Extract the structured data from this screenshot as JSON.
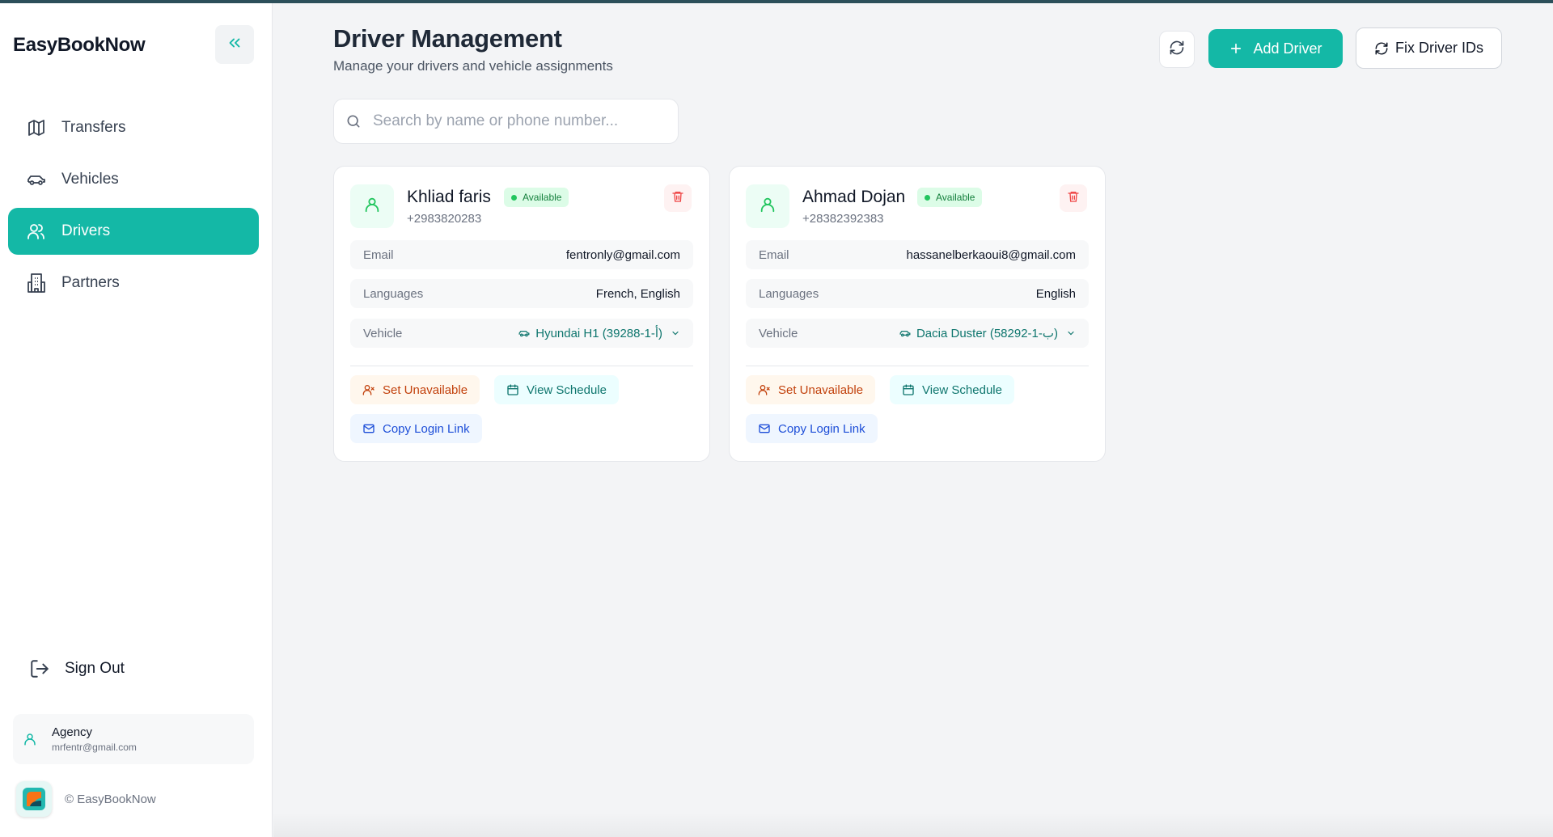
{
  "app": {
    "brand": "EasyBookNow",
    "copyright": "© EasyBookNow"
  },
  "sidebar": {
    "items": [
      {
        "label": "Transfers",
        "icon": "map-icon"
      },
      {
        "label": "Vehicles",
        "icon": "car-icon"
      },
      {
        "label": "Drivers",
        "icon": "users-icon",
        "active": true
      },
      {
        "label": "Partners",
        "icon": "building-icon"
      }
    ],
    "sign_out": "Sign Out",
    "account": {
      "role": "Agency",
      "email": "mrfentr@gmail.com"
    }
  },
  "header": {
    "title": "Driver Management",
    "subtitle": "Manage your drivers and vehicle assignments",
    "add_label": "Add Driver",
    "fix_label": "Fix Driver IDs"
  },
  "search": {
    "placeholder": "Search by name or phone number...",
    "value": ""
  },
  "labels": {
    "email": "Email",
    "languages": "Languages",
    "vehicle": "Vehicle",
    "set_unavailable": "Set Unavailable",
    "view_schedule": "View Schedule",
    "copy_login": "Copy Login Link"
  },
  "drivers": [
    {
      "name": "Khliad faris",
      "status": "Available",
      "phone": "+2983820283",
      "email": "fentronly@gmail.com",
      "languages": "French, English",
      "vehicle": "Hyundai H1 (39288-1-أ)"
    },
    {
      "name": "Ahmad Dojan",
      "status": "Available",
      "phone": "+28382392383",
      "email": "hassanelberkaoui8@gmail.com",
      "languages": "English",
      "vehicle": "Dacia Duster (58292-1-ب)"
    }
  ],
  "colors": {
    "accent": "#14b8a6",
    "danger": "#ef4444",
    "available": "#22c55e"
  }
}
